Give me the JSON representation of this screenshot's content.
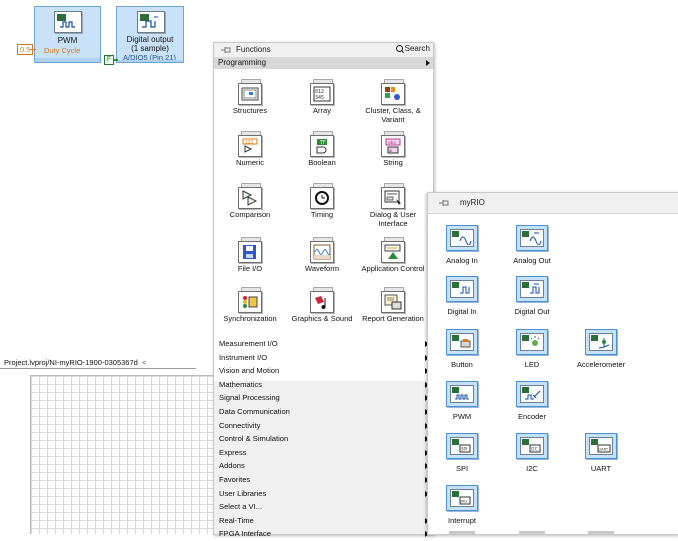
{
  "block_diagram": {
    "pwm_node": {
      "title": "PWM",
      "terminal": "Duty Cycle",
      "constant": "0.5"
    },
    "dout_node": {
      "title_line1": "Digital output",
      "title_line2": "(1 sample)",
      "terminal": "A/DIO5 (Pin 21)",
      "bool_constant": "F"
    }
  },
  "project_window": {
    "tab_title": "Project.lvproj/NI-myRIO-1900-0305367d",
    "tab_close": "<"
  },
  "functions_palette": {
    "title": "Functions",
    "search_label": "Search",
    "category": "Programming",
    "items": [
      {
        "label": "Structures",
        "icon": "structures-icon"
      },
      {
        "label": "Array",
        "icon": "array-icon"
      },
      {
        "label": "Cluster, Class, & Variant",
        "icon": "cluster-icon"
      },
      {
        "label": "Numeric",
        "icon": "numeric-icon"
      },
      {
        "label": "Boolean",
        "icon": "boolean-icon"
      },
      {
        "label": "String",
        "icon": "string-icon"
      },
      {
        "label": "Comparison",
        "icon": "comparison-icon"
      },
      {
        "label": "Timing",
        "icon": "timing-icon"
      },
      {
        "label": "Dialog & User Interface",
        "icon": "dialog-icon"
      },
      {
        "label": "File I/O",
        "icon": "file-io-icon"
      },
      {
        "label": "Waveform",
        "icon": "waveform-icon"
      },
      {
        "label": "Application Control",
        "icon": "app-control-icon"
      },
      {
        "label": "Synchronization",
        "icon": "synchronization-icon"
      },
      {
        "label": "Graphics & Sound",
        "icon": "graphics-sound-icon"
      },
      {
        "label": "Report Generation",
        "icon": "report-icon"
      }
    ],
    "categories": [
      "Measurement I/O",
      "Instrument I/O",
      "Vision and Motion",
      "Mathematics",
      "Signal Processing",
      "Data Communication",
      "Connectivity",
      "Control & Simulation",
      "Express",
      "Addons",
      "Favorites",
      "User Libraries",
      "Select a VI...",
      "Real-Time",
      "FPGA Interface"
    ]
  },
  "myrio_palette": {
    "title": "myRIO",
    "items": [
      {
        "label": "Analog In",
        "icon": "analog-in-icon"
      },
      {
        "label": "Analog Out",
        "icon": "analog-out-icon"
      },
      {
        "label": "Digital In",
        "icon": "digital-in-icon"
      },
      {
        "label": "Digital Out",
        "icon": "digital-out-icon"
      },
      {
        "label": "Button",
        "icon": "button-icon"
      },
      {
        "label": "LED",
        "icon": "led-icon"
      },
      {
        "label": "Accelerometer",
        "icon": "accelerometer-icon"
      },
      {
        "label": "PWM",
        "icon": "pwm-icon"
      },
      {
        "label": "Encoder",
        "icon": "encoder-icon"
      },
      {
        "label": "SPI",
        "icon": "spi-icon"
      },
      {
        "label": "I2C",
        "icon": "i2c-icon"
      },
      {
        "label": "UART",
        "icon": "uart-icon"
      },
      {
        "label": "Interrupt",
        "icon": "interrupt-icon"
      }
    ]
  }
}
